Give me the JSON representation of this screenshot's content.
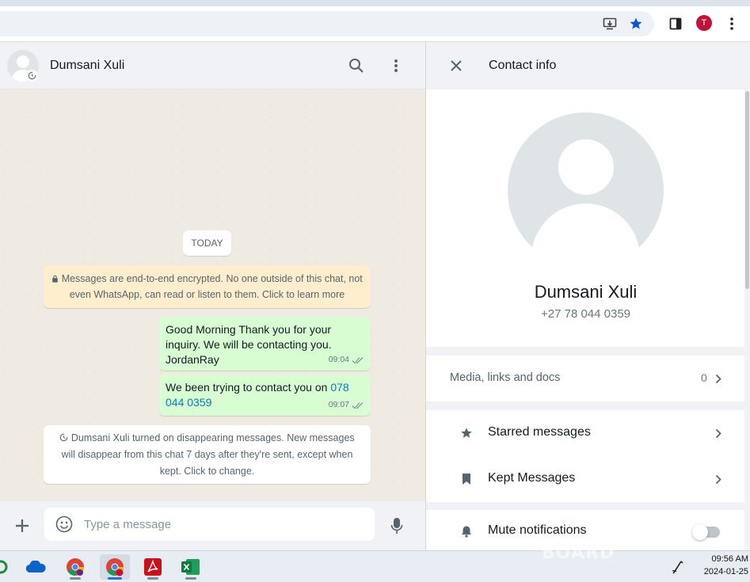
{
  "browser": {
    "profile_initial": "T",
    "icons": [
      "install-app-icon",
      "bookmark-star-icon",
      "side-panel-icon",
      "kebab-menu-icon"
    ]
  },
  "chat": {
    "contact_name": "Dumsani Xuli",
    "date_divider": "TODAY",
    "encryption_notice": "Messages are end-to-end encrypted. No one outside of this chat, not even WhatsApp, can read or listen to them. Click to learn more",
    "messages": [
      {
        "text": "Good Morning Thank you for your inquiry. We will be contacting you. JordanRay",
        "time": "09:04"
      },
      {
        "text_before_link": "We been trying to contact you on ",
        "link": "078 044 0359",
        "time": "09:07"
      }
    ],
    "system_notice": "Dumsani Xuli turned on disappearing messages. New messages will disappear from this chat 7 days after they're sent, except when kept. Click to change.",
    "composer_placeholder": "Type a message"
  },
  "contact_info": {
    "title": "Contact info",
    "name": "Dumsani Xuli",
    "phone": "+27 78 044 0359",
    "media_label": "Media, links and docs",
    "media_count": "0",
    "options": [
      {
        "label": "Starred messages",
        "icon": "star-icon"
      },
      {
        "label": "Kept Messages",
        "icon": "bookmark-icon"
      }
    ],
    "mute_label": "Mute notifications",
    "mute_on": false
  },
  "taskbar": {
    "apps": [
      "onedrive",
      "chrome",
      "chrome-profile",
      "acrobat",
      "excel"
    ],
    "time": "09:56 AM",
    "date": "2024-01-25",
    "watermark": "BOARD"
  },
  "colors": {
    "outgoing_bubble": "#d9fdd3",
    "encryption_bg": "#ffeecd",
    "chat_bg": "#efeae2",
    "link": "#027eb5",
    "profile_red": "#c0133a"
  }
}
